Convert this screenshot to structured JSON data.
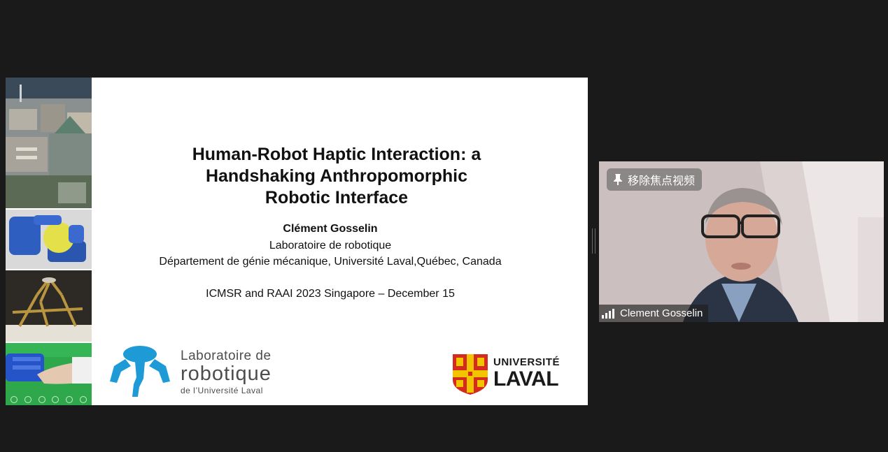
{
  "slide": {
    "title_lines": [
      "Human-Robot Haptic Interaction: a",
      "Handshaking Anthropomorphic",
      "Robotic Interface"
    ],
    "author": "Clément Gosselin",
    "lab": "Laboratoire de robotique",
    "department": "Département de génie mécanique, Université Laval,Québec, Canada",
    "conference": "ICMSR and RAAI 2023 Singapore – December 15",
    "lab_logo": {
      "line1": "Laboratoire de",
      "line2": "robotique",
      "line3": "de l’Université Laval",
      "color": "#1e9bd7"
    },
    "university_logo": {
      "line1": "UNIVERSITÉ",
      "line2": "LAVAL",
      "shield_red": "#d52b1e",
      "shield_gold": "#f2c400"
    },
    "side_photos": [
      "quebec-city-photo",
      "robot-hand-ball-photo",
      "parallel-robot-photo",
      "handshake-robot-photo"
    ]
  },
  "video": {
    "unpin_label": "移除焦点视频",
    "participant_name": "Clement Gosselin"
  },
  "icons": [
    "pin-icon",
    "signal-icon"
  ]
}
